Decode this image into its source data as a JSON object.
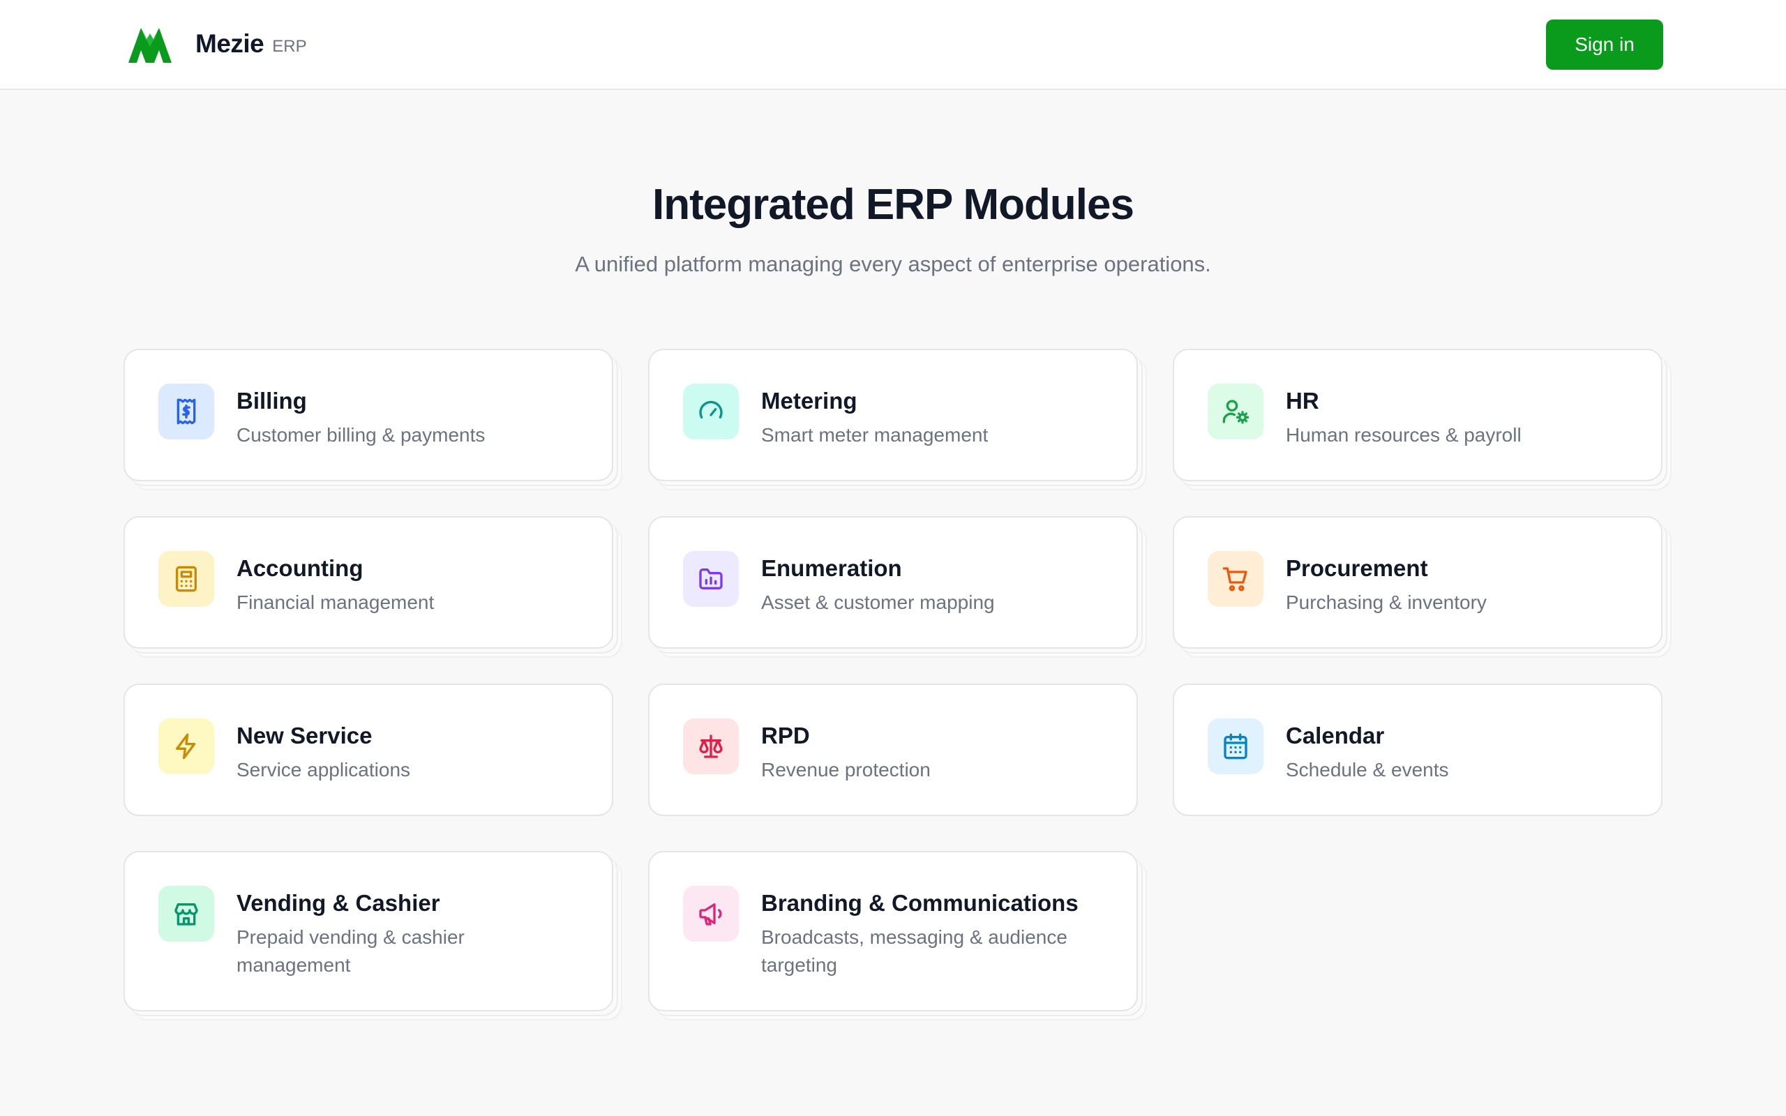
{
  "header": {
    "brand_name": "Mezie",
    "brand_suffix": "ERP",
    "sign_in_label": "Sign in",
    "accent_color": "#0a9a1c"
  },
  "hero": {
    "title": "Integrated ERP Modules",
    "subtitle": "A unified platform managing every aspect of enterprise operations."
  },
  "modules": [
    {
      "title": "Billing",
      "description": "Customer billing & payments",
      "icon": "receipt-dollar-icon",
      "icon_color": "#2563eb",
      "icon_bg": "#dbeafe"
    },
    {
      "title": "Metering",
      "description": "Smart meter management",
      "icon": "gauge-icon",
      "icon_color": "#0d9488",
      "icon_bg": "#ccfbf1"
    },
    {
      "title": "HR",
      "description": "Human resources & payroll",
      "icon": "user-cog-icon",
      "icon_color": "#16a34a",
      "icon_bg": "#dcfce7"
    },
    {
      "title": "Accounting",
      "description": "Financial management",
      "icon": "calculator-icon",
      "icon_color": "#ca8a04",
      "icon_bg": "#fef3c7"
    },
    {
      "title": "Enumeration",
      "description": "Asset & customer mapping",
      "icon": "folder-chart-icon",
      "icon_color": "#7c3aed",
      "icon_bg": "#ede9fe"
    },
    {
      "title": "Procurement",
      "description": "Purchasing & inventory",
      "icon": "shopping-cart-icon",
      "icon_color": "#ea580c",
      "icon_bg": "#ffedd5"
    },
    {
      "title": "New Service",
      "description": "Service applications",
      "icon": "lightning-icon",
      "icon_color": "#ca8a04",
      "icon_bg": "#fef9c3"
    },
    {
      "title": "RPD",
      "description": "Revenue protection",
      "icon": "scale-icon",
      "icon_color": "#e11d48",
      "icon_bg": "#ffe4e6"
    },
    {
      "title": "Calendar",
      "description": "Schedule & events",
      "icon": "calendar-icon",
      "icon_color": "#0284c7",
      "icon_bg": "#e0f2fe"
    },
    {
      "title": "Vending & Cashier",
      "description": "Prepaid vending & cashier management",
      "icon": "store-icon",
      "icon_color": "#059669",
      "icon_bg": "#d1fae5"
    },
    {
      "title": "Branding & Communications",
      "description": "Broadcasts, messaging & audience targeting",
      "icon": "megaphone-icon",
      "icon_color": "#db2777",
      "icon_bg": "#fce7f3"
    }
  ]
}
